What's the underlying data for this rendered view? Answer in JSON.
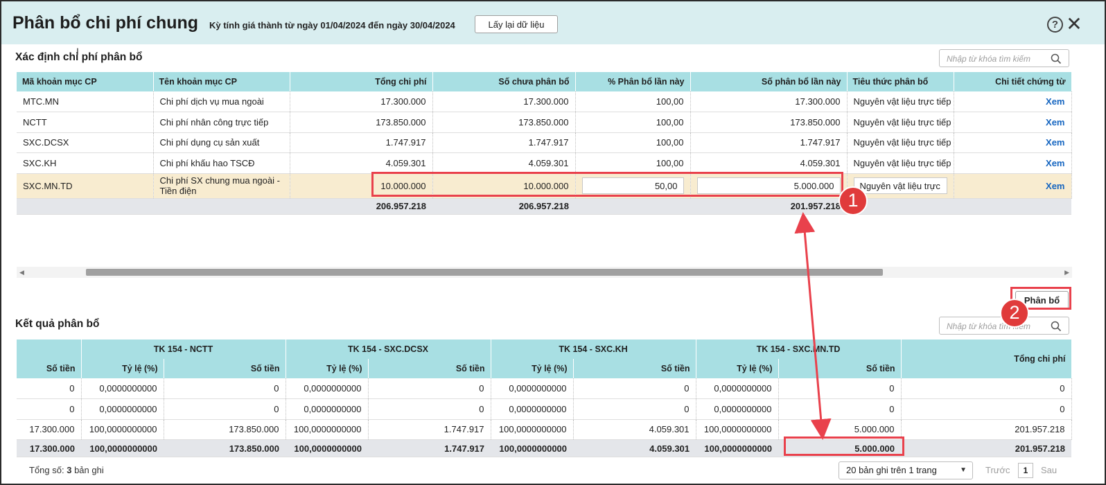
{
  "header": {
    "title": "Phân bổ chi phí chung",
    "period": "Kỳ tính giá thành từ ngày 01/04/2024 đến ngày 30/04/2024",
    "reload_label": "Lấy lại dữ liệu",
    "help_glyph": "?",
    "close_glyph": "✕"
  },
  "section1": {
    "title": "Xác định chi phí phân bổ",
    "search_placeholder": "Nhập từ khóa tìm kiếm",
    "columns": [
      "Mã khoản mục CP",
      "Tên khoản mục CP",
      "Tổng chi phí",
      "Số chưa phân bổ",
      "% Phân bổ lần này",
      "Số phân bổ lần này",
      "Tiêu thức phân bổ",
      "Chi tiết chứng từ"
    ],
    "rows": [
      {
        "code": "MTC.MN",
        "name": "Chi phí dịch vụ mua ngoài",
        "total": "17.300.000",
        "unallocated": "17.300.000",
        "percent": "100,00",
        "amount": "17.300.000",
        "criteria": "Nguyên vật liệu trực tiếp",
        "detail": "Xem"
      },
      {
        "code": "NCTT",
        "name": "Chi phí nhân công trực tiếp",
        "total": "173.850.000",
        "unallocated": "173.850.000",
        "percent": "100,00",
        "amount": "173.850.000",
        "criteria": "Nguyên vật liệu trực tiếp",
        "detail": "Xem"
      },
      {
        "code": "SXC.DCSX",
        "name": "Chi phí dụng cụ sản xuất",
        "total": "1.747.917",
        "unallocated": "1.747.917",
        "percent": "100,00",
        "amount": "1.747.917",
        "criteria": "Nguyên vật liệu trực tiếp",
        "detail": "Xem"
      },
      {
        "code": "SXC.KH",
        "name": "Chi phí khấu hao TSCĐ",
        "total": "4.059.301",
        "unallocated": "4.059.301",
        "percent": "100,00",
        "amount": "4.059.301",
        "criteria": "Nguyên vật liệu trực tiếp",
        "detail": "Xem"
      },
      {
        "code": "SXC.MN.TD",
        "name": "Chi phí SX chung mua ngoài - Tiền điện",
        "total": "10.000.000",
        "unallocated": "10.000.000",
        "percent": "50,00",
        "amount": "5.000.000",
        "criteria": "Nguyên vật liệu trực tiếp",
        "detail": "Xem"
      }
    ],
    "totals": {
      "total": "206.957.218",
      "unallocated": "206.957.218",
      "amount": "201.957.218"
    }
  },
  "section2": {
    "title": "Kết quả phân bổ",
    "allocate_label": "Phân bổ",
    "search_placeholder": "Nhập từ khóa tìm kiếm",
    "groups": [
      "TK 154 - NCTT",
      "TK 154 - SXC.DCSX",
      "TK 154 - SXC.KH",
      "TK 154 - SXC.MN.TD"
    ],
    "total_header": "Tổng chi phí",
    "sub_columns": [
      "Số tiền",
      "Tỷ lệ (%)",
      "Số tiền",
      "Tỷ lệ (%)",
      "Số tiền",
      "Tỷ lệ (%)",
      "Số tiền",
      "Tỷ lệ (%)",
      "Số tiền"
    ],
    "rows": [
      [
        "0",
        "0,0000000000",
        "0",
        "0,0000000000",
        "0",
        "0,0000000000",
        "0",
        "0,0000000000",
        "0",
        "0"
      ],
      [
        "0",
        "0,0000000000",
        "0",
        "0,0000000000",
        "0",
        "0,0000000000",
        "0",
        "0,0000000000",
        "0",
        "0"
      ],
      [
        "17.300.000",
        "100,0000000000",
        "173.850.000",
        "100,0000000000",
        "1.747.917",
        "100,0000000000",
        "4.059.301",
        "100,0000000000",
        "5.000.000",
        "201.957.218"
      ]
    ],
    "totals": [
      "17.300.000",
      "100,0000000000",
      "173.850.000",
      "100,0000000000",
      "1.747.917",
      "100,0000000000",
      "4.059.301",
      "100,0000000000",
      "5.000.000",
      "201.957.218"
    ]
  },
  "footer": {
    "total_prefix": "Tổng số:",
    "total_count": "3",
    "total_suffix": "bản ghi",
    "page_size": "20 bản ghi trên 1 trang",
    "prev_label": "Trước",
    "current_page": "1",
    "next_label": "Sau"
  },
  "annotations": {
    "step1": "1",
    "step2": "2"
  },
  "colors": {
    "header_bg": "#d9eef0",
    "table_header_bg": "#a8dfe3",
    "selected_row_bg": "#f8ecd0",
    "total_row_bg": "#e4e6ea",
    "link": "#1565c0",
    "annotation": "#e9414c"
  }
}
